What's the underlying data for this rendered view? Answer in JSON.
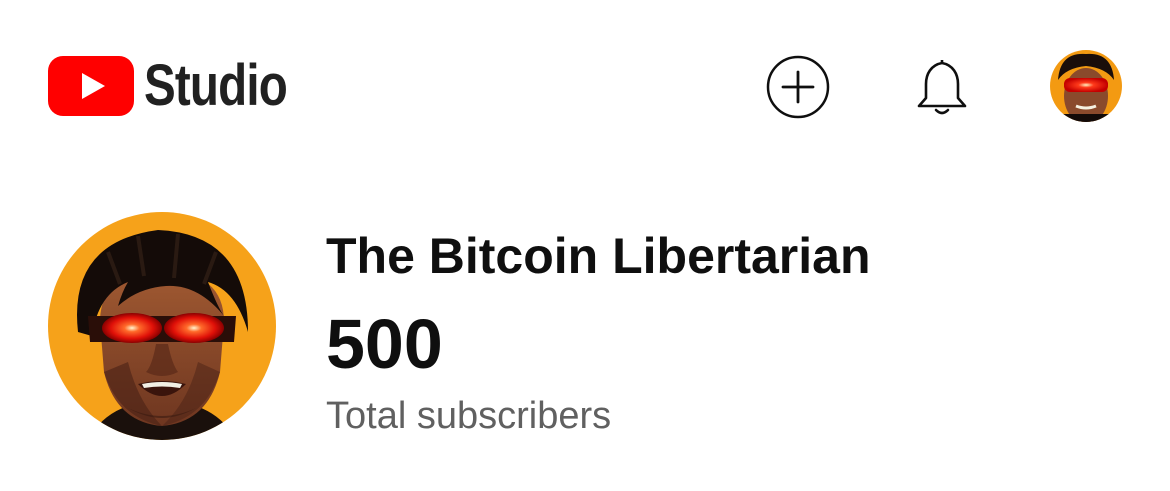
{
  "header": {
    "logo_text": "Studio",
    "icons": [
      "youtube-logo-icon",
      "create-plus-icon",
      "notifications-bell-icon",
      "account-avatar"
    ],
    "colors": {
      "brand_red": "#ff0000",
      "text": "#0f0f0f"
    }
  },
  "channel": {
    "name": "The Bitcoin Libertarian",
    "subscriber_count": "500",
    "subscriber_label": "Total subscribers"
  }
}
